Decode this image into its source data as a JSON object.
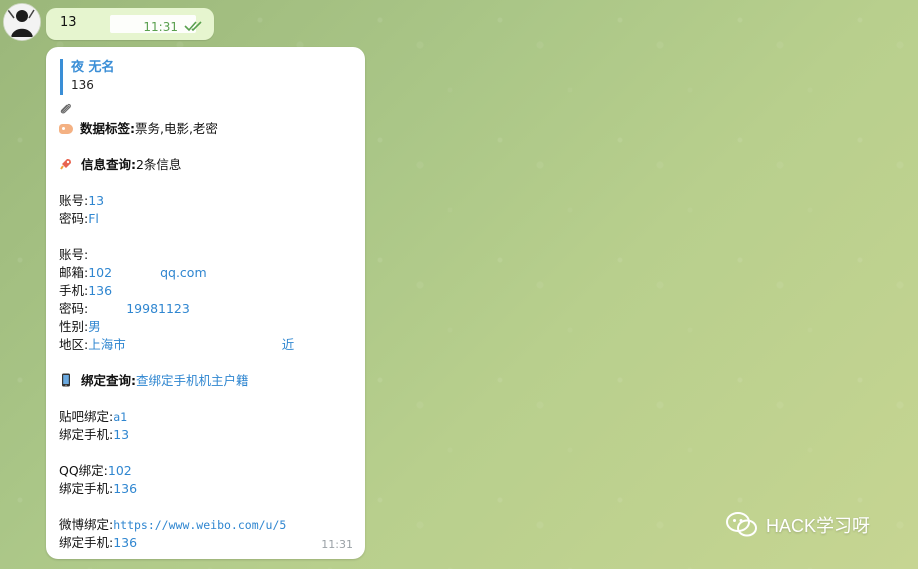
{
  "chat": {
    "top_message": {
      "text": "13",
      "time": "11:31"
    },
    "reply": {
      "quote_name": "夜 无名",
      "quote_sub": "136",
      "attachment_text": "#",
      "tag_label": "数据标签:",
      "tag_value": "票务,电影,老密",
      "info_label": "信息查询:",
      "info_value": "2条信息",
      "rec1_account_label": "账号:",
      "rec1_account_value": "13",
      "rec1_password_label": "密码:",
      "rec1_password_value": "Fl",
      "rec2_account_label": "账号:",
      "rec2_email_label": "邮箱:",
      "rec2_email_prefix": "102",
      "rec2_email_suffix": "qq.com",
      "rec2_phone_label": "手机:",
      "rec2_phone_value": "136",
      "rec2_password_label": "密码:",
      "rec2_password_value": "19981123",
      "rec2_gender_label": "性别:",
      "rec2_gender_value": "男",
      "rec2_region_label": "地区:",
      "rec2_region_value": "上海市",
      "rec2_region_tail": "近",
      "bind_label": "绑定查询:",
      "bind_value": "查绑定手机机主户籍",
      "tieba_label": "贴吧绑定:",
      "tieba_value": "a1",
      "tieba_phone_label": "绑定手机:",
      "tieba_phone_value": "13",
      "qq_label": "QQ绑定:",
      "qq_value": "102",
      "qq_phone_label": "绑定手机:",
      "qq_phone_value": "136",
      "weibo_label": "微博绑定:",
      "weibo_value": "https://www.weibo.com/u/5",
      "weibo_phone_label": "绑定手机:",
      "weibo_phone_value": "136",
      "time": "11:31"
    }
  },
  "watermark": {
    "text": "HACK学习呀"
  },
  "colors": {
    "link": "#2f86d0",
    "outgoing_bubble": "#e6f5cf",
    "incoming_bubble": "#ffffff",
    "time_green": "#5aa04f"
  }
}
